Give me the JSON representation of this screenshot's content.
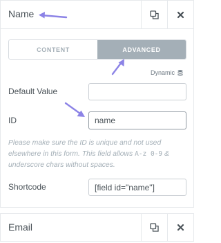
{
  "colors": {
    "accent": "#8c83e6",
    "tab_active_bg": "#a4afb7",
    "border": "#e6e9ec"
  },
  "top_field": {
    "title": "Name",
    "duplicate_icon": "duplicate-icon",
    "remove_icon": "close-icon"
  },
  "tabs": [
    {
      "label": "CONTENT",
      "active": false
    },
    {
      "label": "ADVANCED",
      "active": true
    }
  ],
  "dynamic": {
    "label": "Dynamic",
    "icon": "database-icon"
  },
  "form": {
    "default_value": {
      "label": "Default Value",
      "value": ""
    },
    "id": {
      "label": "ID",
      "value": "name"
    },
    "help": {
      "text_before": "Please make sure the ID is unique and not used elsewhere in this form. This field allows ",
      "code": "A-z 0-9",
      "text_after": " & underscore chars without spaces."
    },
    "shortcode": {
      "label": "Shortcode",
      "value": "[field id=\"name\"]"
    }
  },
  "bottom_field": {
    "title": "Email",
    "duplicate_icon": "duplicate-icon",
    "remove_icon": "close-icon"
  },
  "annotations": {
    "arrow_icon": "annotation-arrow-icon",
    "count": 3
  }
}
